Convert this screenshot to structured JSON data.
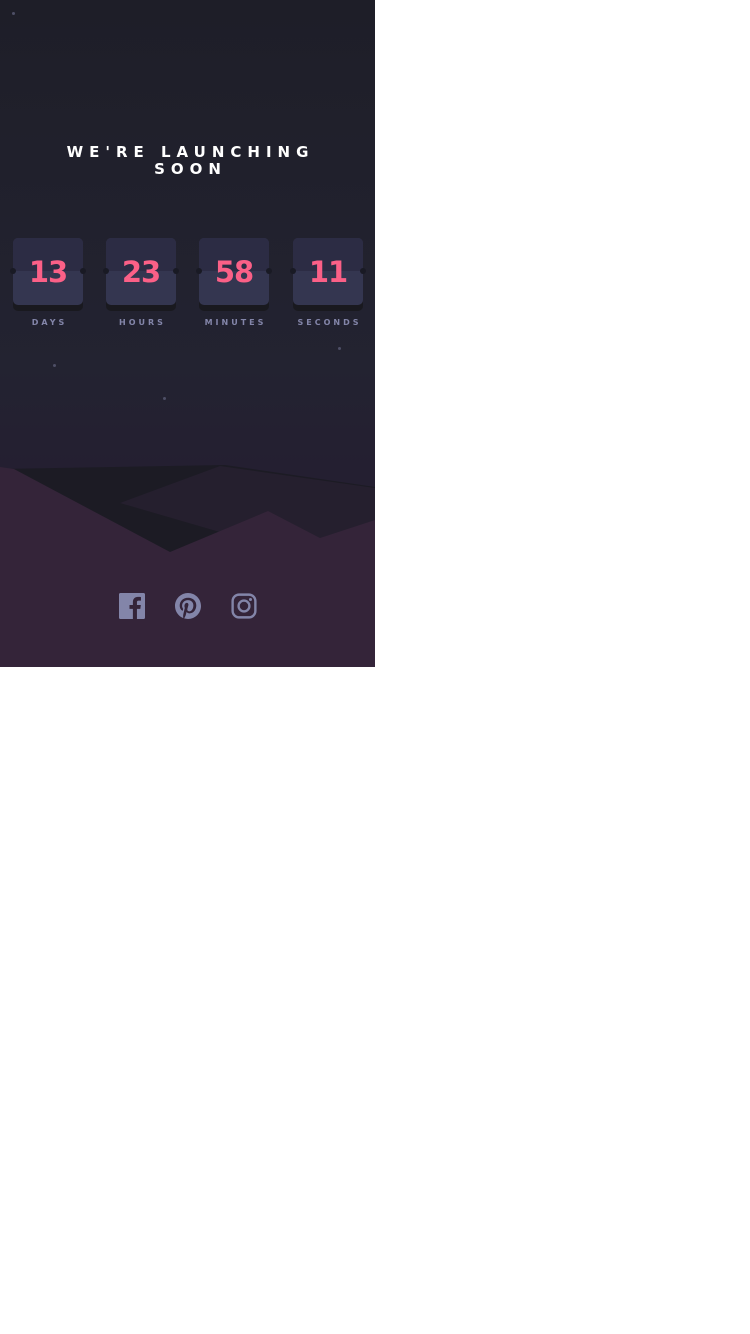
{
  "headline": "We're launching soon",
  "countdown": [
    {
      "value": "13",
      "label": "DAYS"
    },
    {
      "value": "23",
      "label": "HOURS"
    },
    {
      "value": "58",
      "label": "MINUTES"
    },
    {
      "value": "11",
      "label": "SECONDS"
    }
  ],
  "social": [
    {
      "icon": "facebook-icon"
    },
    {
      "icon": "pinterest-icon"
    },
    {
      "icon": "instagram-icon"
    }
  ],
  "colors": {
    "accent": "#fb6087",
    "card": "#343650",
    "label": "#8385a9",
    "background_top": "#1e1e28",
    "hills": "#342439"
  }
}
